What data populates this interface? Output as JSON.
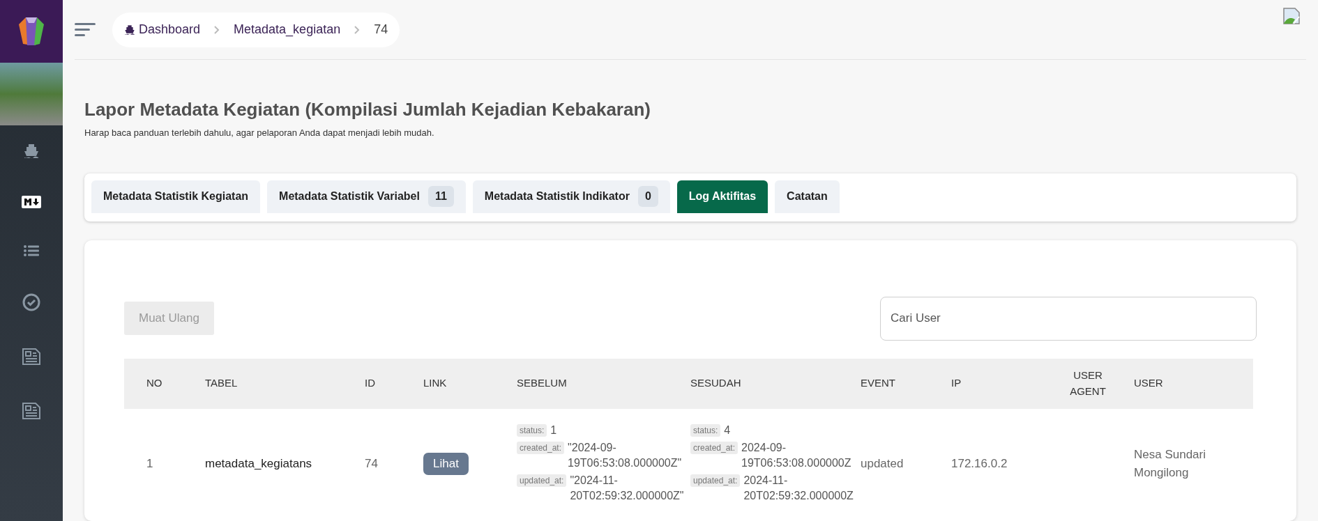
{
  "breadcrumb": [
    {
      "label": "Dashboard"
    },
    {
      "label": "Metadata_kegiatan"
    },
    {
      "label": "74"
    }
  ],
  "page": {
    "title": "Lapor Metadata Kegiatan (Kompilasi Jumlah Kejadian Kebakaran)",
    "subtitle": "Harap baca panduan terlebih dahulu, agar pelaporan Anda dapat menjadi lebih mudah."
  },
  "tabs": [
    {
      "label": "Metadata Statistik Kegiatan",
      "selected": false
    },
    {
      "label": "Metadata Statistik Variabel",
      "badge": "11",
      "selected": false
    },
    {
      "label": "Metadata Statistik Indikator",
      "badge": "0",
      "selected": false
    },
    {
      "label": "Log Aktifitas",
      "selected": true
    },
    {
      "label": "Catatan",
      "selected": false
    }
  ],
  "toolbar": {
    "reload_button": "Muat Ulang",
    "search": {
      "placeholder": "Cari User"
    }
  },
  "table": {
    "columns": [
      "NO",
      "TABEL",
      "ID",
      "LINK",
      "SEBELUM",
      "SESUDAH",
      "EVENT",
      "IP",
      "USER AGENT",
      "USER"
    ],
    "rows": [
      {
        "no": "1",
        "tabel": "metadata_kegiatans",
        "id": "74",
        "link": "Lihat",
        "sebelum": [
          {
            "key": "status:",
            "value": "1"
          },
          {
            "key": "created_at:",
            "value": "\"2024-09-19T06:53:08.000000Z\""
          },
          {
            "key": "updated_at:",
            "value": "\"2024-11-20T02:59:32.000000Z\""
          }
        ],
        "sesudah": [
          {
            "key": "status:",
            "value": "4"
          },
          {
            "key": "created_at:",
            "value": "2024-09-19T06:53:08.000000Z"
          },
          {
            "key": "updated_at:",
            "value": "2024-11-20T02:59:32.000000Z"
          }
        ],
        "event": "updated",
        "ip": "172.16.0.2",
        "user": "Nesa Sundari Mongilong"
      }
    ]
  }
}
